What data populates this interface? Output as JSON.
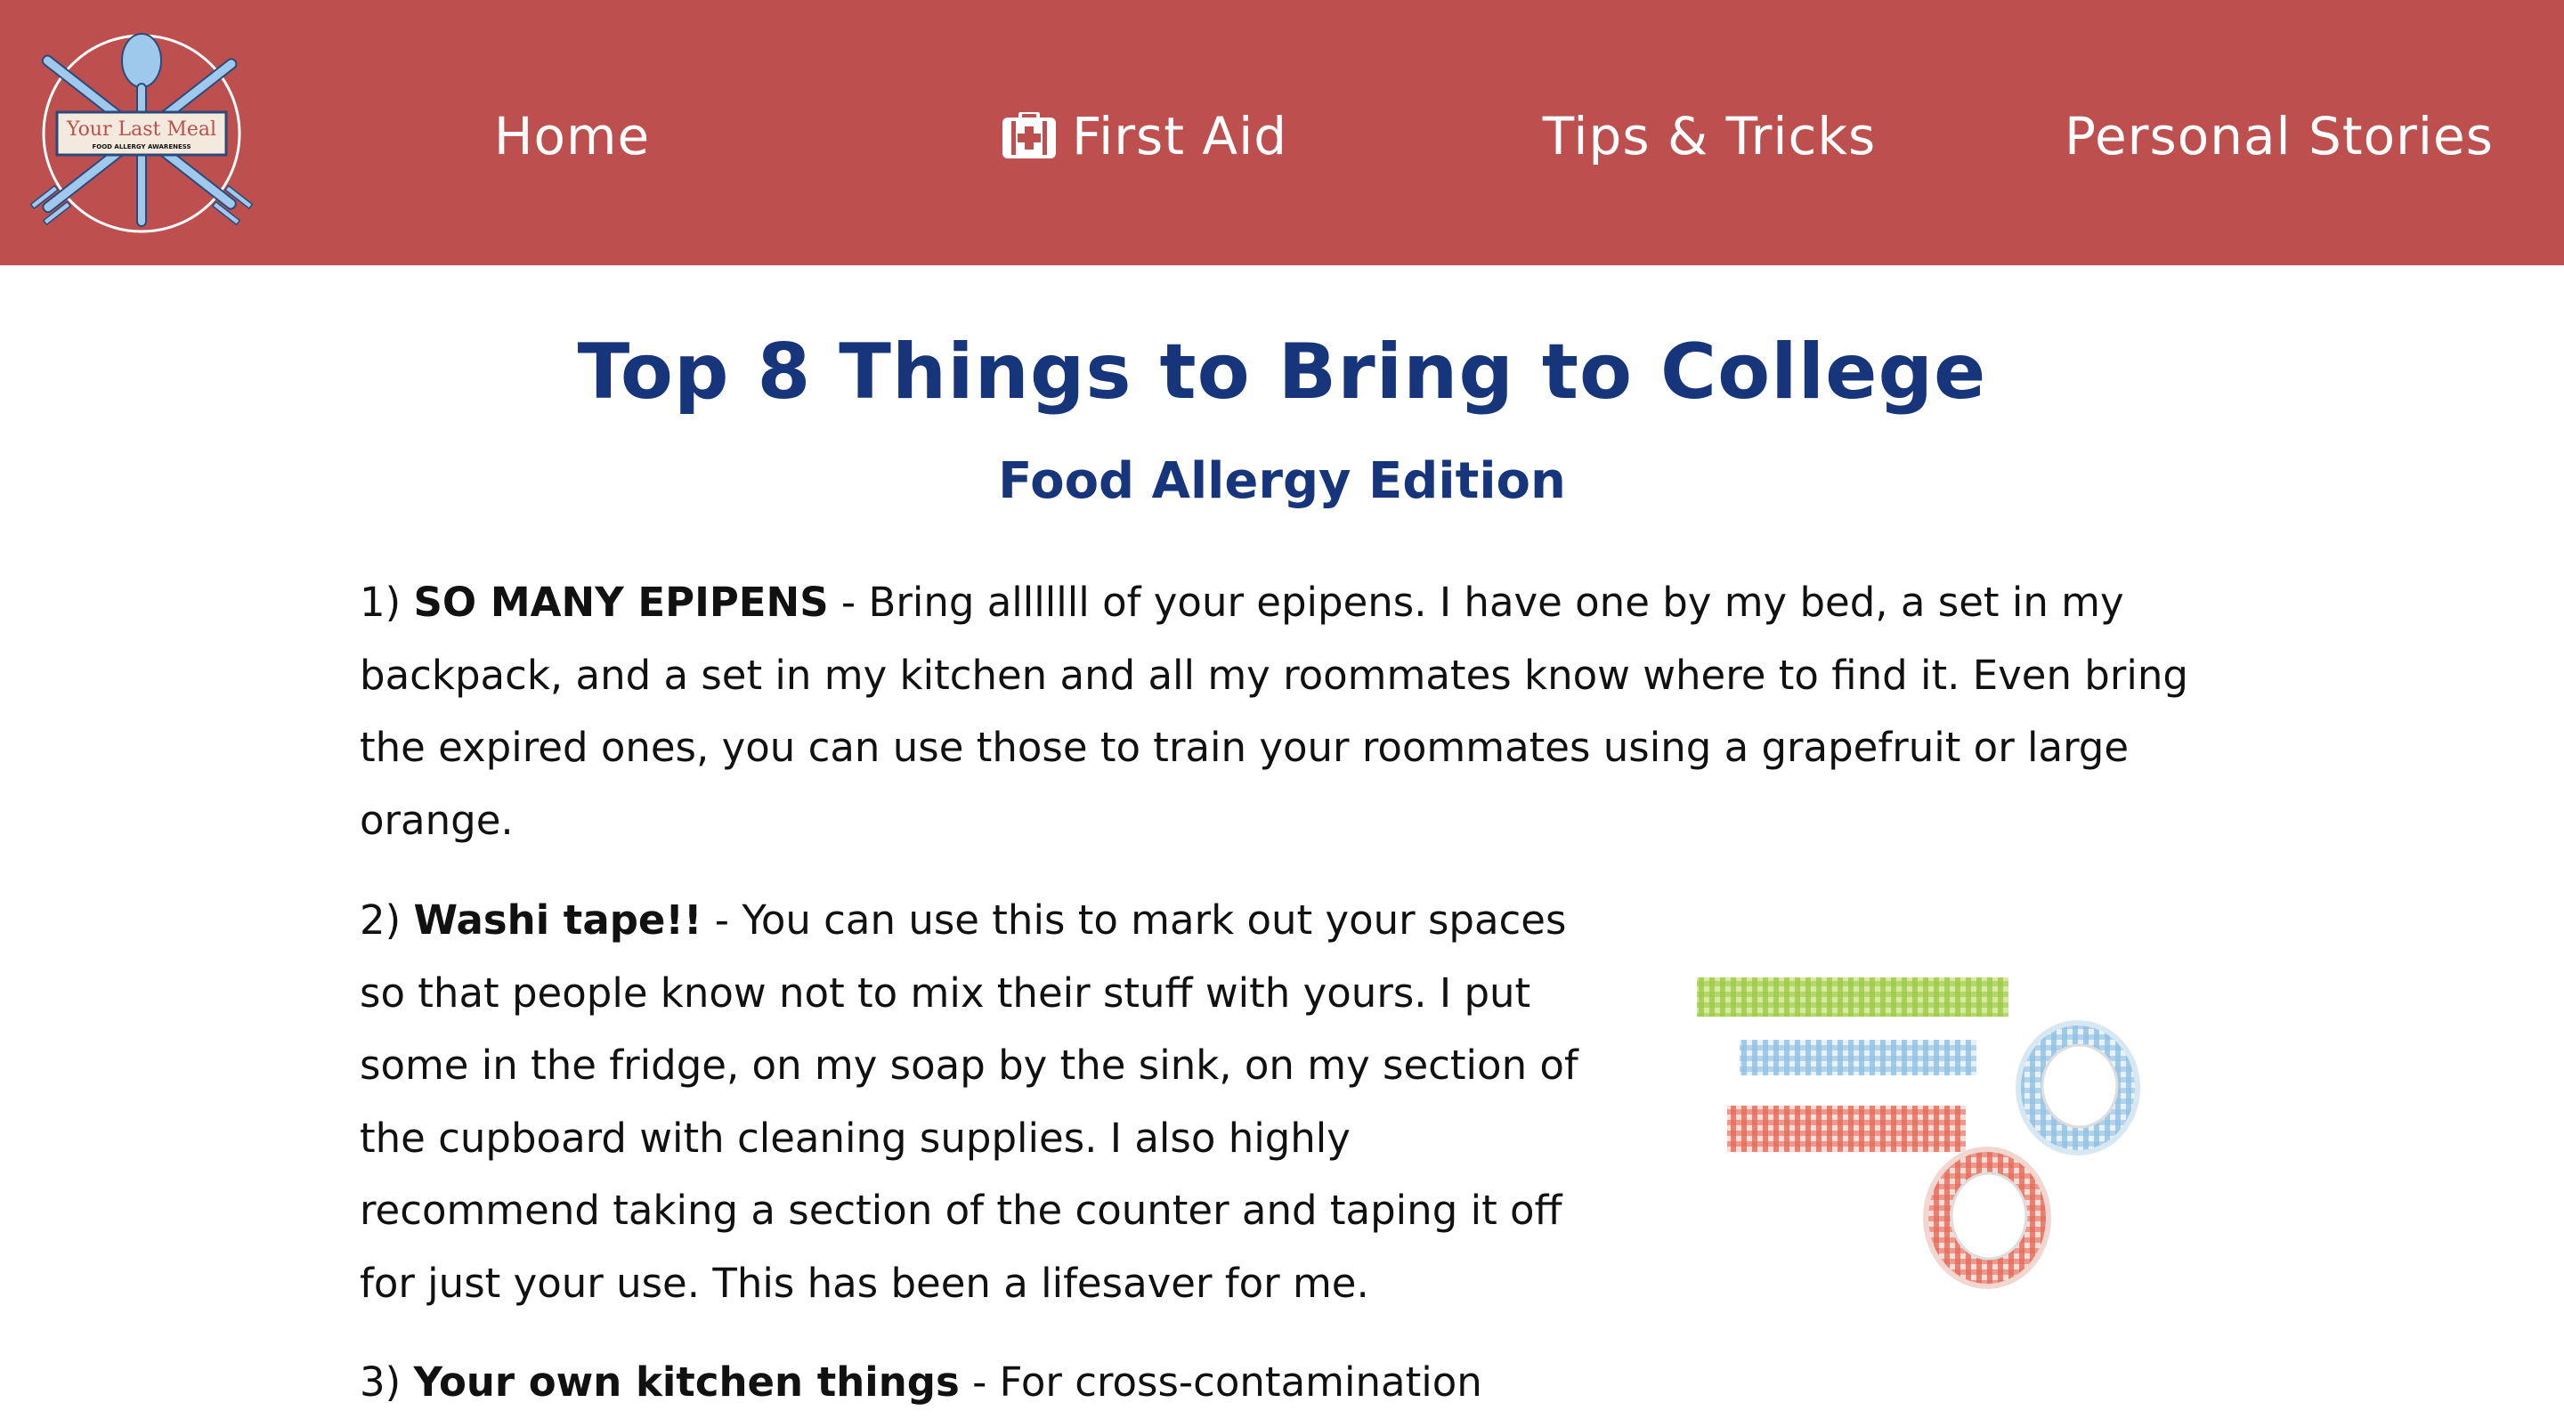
{
  "nav": {
    "logo": {
      "title": "Your Last Meal",
      "tagline": "FOOD ALLERGY AWARENESS"
    },
    "items": [
      {
        "label": "Home",
        "icon": null
      },
      {
        "label": "First Aid",
        "icon": "first-aid-kit-icon"
      },
      {
        "label": "Tips & Tricks",
        "icon": null
      },
      {
        "label": "Personal Stories",
        "icon": null
      }
    ]
  },
  "article": {
    "title": "Top 8 Things to Bring to College",
    "subtitle": "Food Allergy Edition",
    "items": [
      {
        "number": "1)",
        "heading": "SO MANY EPIPENS",
        "text": " - Bring alllllll of your epipens. I have one by my bed, a set in my backpack, and a set in my kitchen and all my roommates know where to find it. Even bring the expired ones, you can use those to train your roommates using a grapefruit or large orange."
      },
      {
        "number": "2)",
        "heading": "Washi tape!!",
        "text": " - You can use this to mark out your spaces so that people know not to mix their stuff with yours. I put some in the fridge, on my soap by the sink, on my section of the cupboard with cleaning supplies. I also highly recommend taking a section of the counter and taping it off for just your use. This has been a lifesaver for me."
      },
      {
        "number": "3)",
        "heading": "Your own kitchen things",
        "text": " - For cross-contamination"
      }
    ]
  },
  "colors": {
    "navbar": "#bd4f4e",
    "title": "#16357a",
    "text": "#111111"
  }
}
